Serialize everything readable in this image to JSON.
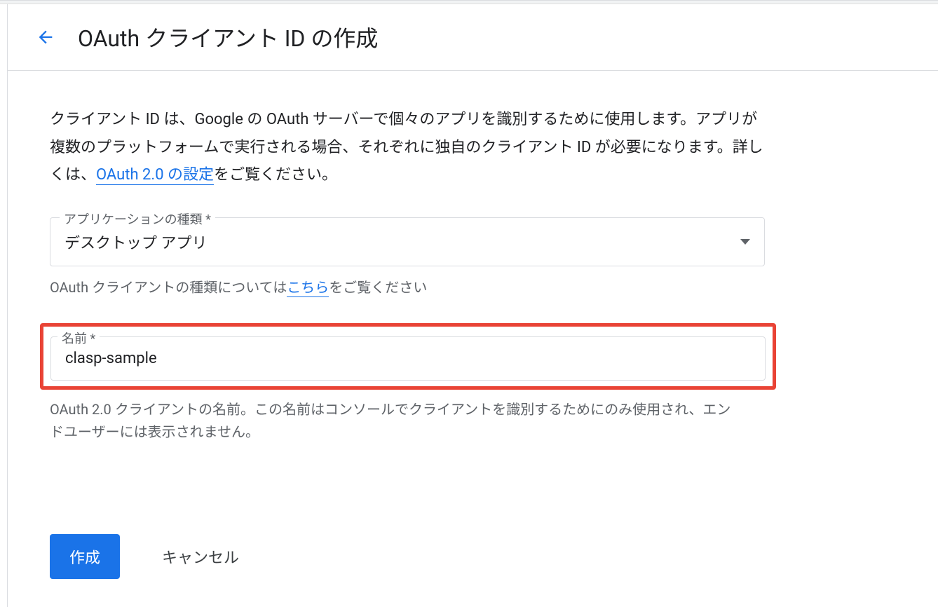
{
  "header": {
    "title": "OAuth クライアント ID の作成"
  },
  "description": {
    "part1": "クライアント ID は、Google の OAuth サーバーで個々のアプリを識別するために使用します。アプリが複数のプラットフォームで実行される場合、それぞれに独自のクライアント ID が必要になります。詳しくは、",
    "link": "OAuth 2.0 の設定",
    "part2": "をご覧ください。"
  },
  "form": {
    "appType": {
      "label": "アプリケーションの種類 *",
      "value": "デスクトップ アプリ",
      "helper_part1": "OAuth クライアントの種類については",
      "helper_link": "こちら",
      "helper_part2": "をご覧ください"
    },
    "name": {
      "label": "名前 *",
      "value": "clasp-sample",
      "helper": "OAuth 2.0 クライアントの名前。この名前はコンソールでクライアントを識別するためにのみ使用され、エンドユーザーには表示されません。"
    }
  },
  "buttons": {
    "create": "作成",
    "cancel": "キャンセル"
  }
}
